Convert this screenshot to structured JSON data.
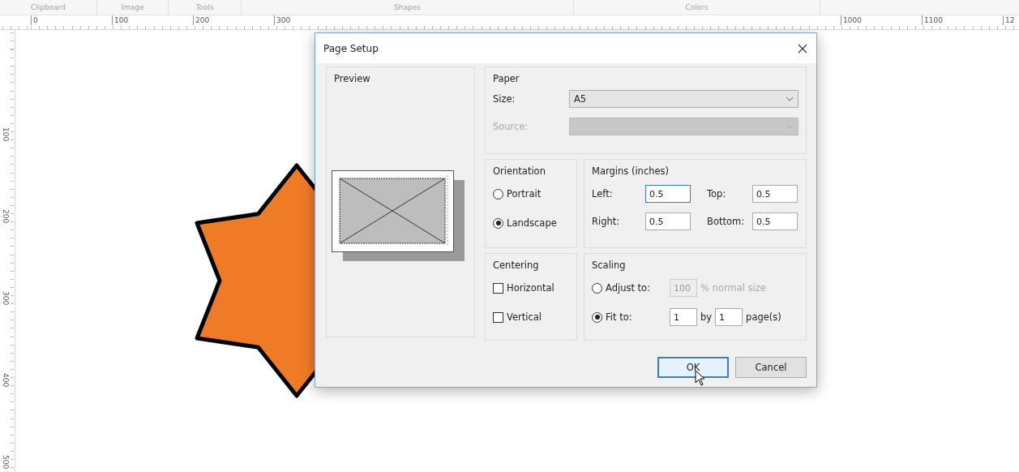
{
  "ribbon": {
    "groups": [
      "Clipboard",
      "Image",
      "Tools",
      "Shapes",
      "Colors"
    ]
  },
  "horizontal_ruler": {
    "left_labels": [
      "0",
      "100",
      "200",
      "300"
    ],
    "right_labels": [
      "1000",
      "1100",
      "12"
    ]
  },
  "vertical_ruler": {
    "labels": [
      "100",
      "200",
      "300",
      "400",
      "500"
    ]
  },
  "canvas": {
    "shape": {
      "kind": "star",
      "color": "#f07b27"
    }
  },
  "dialog": {
    "title": "Page Setup",
    "preview": {
      "label": "Preview"
    },
    "paper": {
      "label": "Paper",
      "size": {
        "label": "Size:",
        "value": "A5",
        "disabled": false
      },
      "source": {
        "label": "Source:",
        "disabled": true
      }
    },
    "orientation": {
      "label": "Orientation",
      "options": [
        {
          "label": "Portrait",
          "selected": false
        },
        {
          "label": "Landscape",
          "selected": true
        }
      ]
    },
    "margins": {
      "label": "Margins (inches)",
      "fields": [
        {
          "label": "Left:",
          "value": "0.5",
          "focused": true
        },
        {
          "label": "Top:",
          "value": "0.5",
          "focused": false
        },
        {
          "label": "Right:",
          "value": "0.5",
          "focused": false
        },
        {
          "label": "Bottom:",
          "value": "0.5",
          "focused": false
        }
      ]
    },
    "centering": {
      "label": "Centering",
      "options": [
        {
          "label": "Horizontal",
          "checked": false
        },
        {
          "label": "Vertical",
          "checked": false
        }
      ]
    },
    "scaling": {
      "label": "Scaling",
      "options": [
        {
          "kind": "adjust",
          "label": "Adjust to:",
          "selected": false,
          "value": "100",
          "suffix": "% normal size"
        },
        {
          "kind": "fit",
          "label": "Fit to:",
          "selected": true,
          "value": "1",
          "joiner": "by",
          "value2": "1",
          "suffix": "page(s)"
        }
      ]
    },
    "buttons": [
      {
        "label": "OK",
        "default": true
      },
      {
        "label": "Cancel",
        "default": false
      }
    ]
  }
}
